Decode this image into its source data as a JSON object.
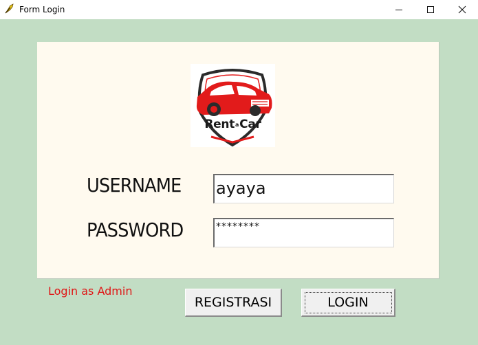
{
  "window": {
    "title": "Form Login",
    "app_icon": "feather-icon",
    "minimize_icon": "minimize-icon",
    "maximize_icon": "maximize-icon",
    "close_icon": "close-icon"
  },
  "logo": {
    "brand_left": "Rent",
    "brand_mid": "a",
    "brand_right": "Car",
    "icon": "car-shield-logo",
    "colors": {
      "car": "#e21b1b",
      "shield": "#2b2b2b"
    }
  },
  "form": {
    "username_label": "USERNAME",
    "username_value": "ayaya",
    "password_label": "PASSWORD",
    "password_value": "********"
  },
  "links": {
    "admin_login": "Login as Admin"
  },
  "buttons": {
    "register": "REGISTRASI",
    "login": "LOGIN"
  },
  "colors": {
    "background": "#c2ddc4",
    "card": "#fffaef",
    "admin_link": "#e01616"
  }
}
